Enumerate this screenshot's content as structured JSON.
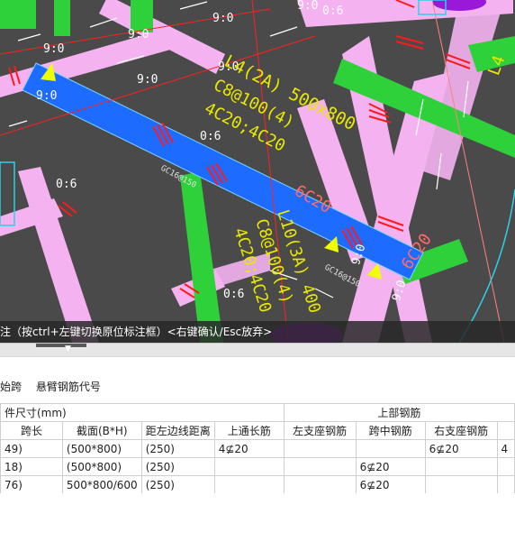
{
  "canvas": {
    "annotations": {
      "beam1_name": "L4(2A) 500x800",
      "beam1_stirrup": "C8@100(4)",
      "beam1_top": "4C20;4C20",
      "beam2_name": "L10(3A) 400",
      "beam2_stirrup": "C8@100(4)",
      "beam2_top": "4C20;4C20",
      "support_left": "6C20",
      "support_right": "6C20",
      "small_text_1": "GC16@150",
      "small_text_2": "GC16@150",
      "side_label": "L4",
      "dim_labels": [
        "9:0",
        "9:0",
        "9:0",
        "9:0",
        "9:0",
        "9:0",
        "9:0",
        "0:6",
        "0:6",
        "0:6",
        "0:6",
        "9:0",
        "9:0"
      ]
    },
    "colors": {
      "background": "#4a4a4a",
      "beam_pink": "#f4b3f0",
      "beam_green": "#2ed13a",
      "beam_blue": "#1e6cff",
      "annotation_yellow": "#e8e800",
      "rebar_red": "#ff1a1a",
      "support_text": "#ff6a6a"
    }
  },
  "status_bar": {
    "text": "注（按ctrl+左键切换原位标注框）<右键确认/Esc放弃>"
  },
  "toolbar": {
    "item1": "始跨",
    "item2": "悬臂钢筋代号"
  },
  "table": {
    "group_size": "件尺寸(mm)",
    "group_top_rebar": "上部钢筋",
    "headers": {
      "span_length": "跨长",
      "section": "截面(B*H)",
      "edge_distance": "距左边线距离",
      "through_rebar": "上通长筋",
      "left_support": "左支座钢筋",
      "mid_span": "跨中钢筋",
      "right_support": "右支座钢筋"
    },
    "rows": [
      {
        "span": "49)",
        "section": "(500*800)",
        "edge": "(250)",
        "through": "4⊈20",
        "left": "",
        "mid": "",
        "right": "6⊈20",
        "extra": "4"
      },
      {
        "span": "18)",
        "section": "(500*800)",
        "edge": "(250)",
        "through": "",
        "left": "",
        "mid": "6⊈20",
        "right": "",
        "extra": ""
      },
      {
        "span": "76)",
        "section": "500*800/600",
        "edge": "(250)",
        "through": "",
        "left": "",
        "mid": "6⊈20",
        "right": "",
        "extra": ""
      }
    ]
  }
}
